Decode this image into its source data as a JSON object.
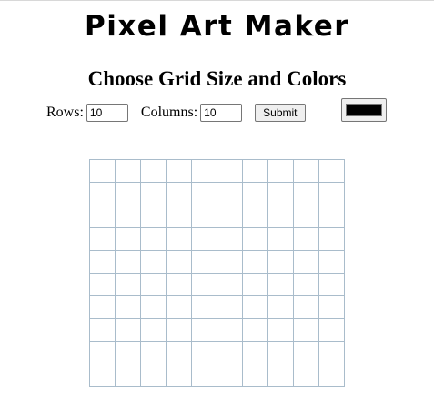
{
  "header": {
    "app_title": "Pixel Art Maker",
    "section_title": "Choose Grid Size and Colors"
  },
  "form": {
    "rows_label": "Rows:",
    "rows_value": "10",
    "columns_label": "Columns:",
    "columns_value": "10",
    "submit_label": "Submit",
    "selected_color": "#000000"
  },
  "grid": {
    "rows": 10,
    "columns": 10,
    "cell_border_color": "#a9bccb"
  }
}
